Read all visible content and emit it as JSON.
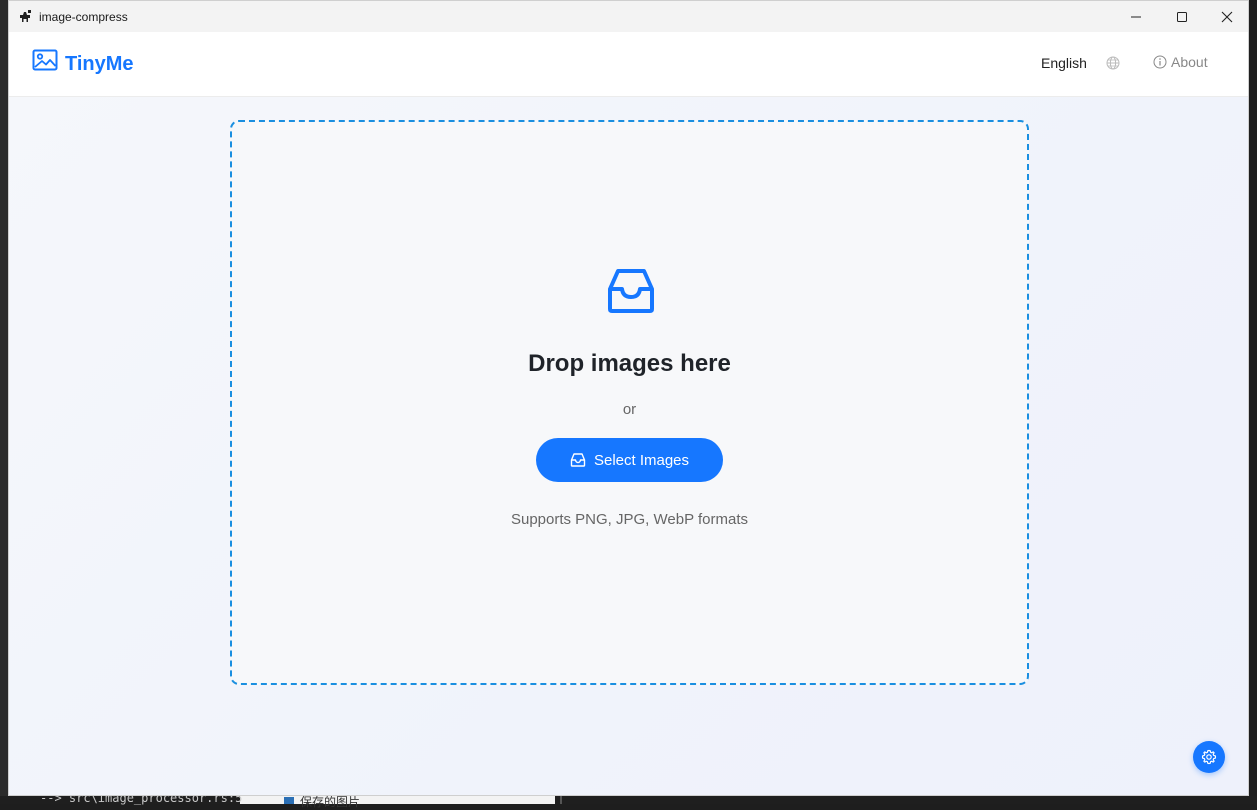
{
  "window": {
    "title": "image-compress"
  },
  "header": {
    "brand": "TinyMe",
    "language": "English",
    "about_label": "About"
  },
  "dropzone": {
    "title": "Drop images here",
    "or_text": "or",
    "select_button_label": "Select Images",
    "formats_text": "Supports PNG, JPG, WebP formats"
  },
  "background": {
    "code_snippet": "--> src\\image_processor.rs:5",
    "file_label": "保存的图片"
  },
  "colors": {
    "accent": "#1677ff",
    "dropzone_border": "#1a8fe0",
    "title_text": "#1f2329"
  }
}
